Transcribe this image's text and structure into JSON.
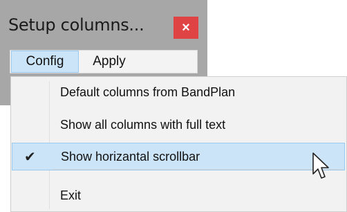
{
  "window": {
    "title": "Setup columns...",
    "close_glyph": "×"
  },
  "menubar": {
    "items": [
      {
        "label": "Config",
        "active": true
      },
      {
        "label": "Apply",
        "active": false
      }
    ]
  },
  "dropdown": {
    "items": [
      {
        "label": "Default columns from BandPlan",
        "checked": false,
        "highlighted": false
      },
      {
        "label": "Show all columns with full text",
        "checked": false,
        "highlighted": false
      },
      {
        "label": "Show horizantal scrollbar",
        "checked": true,
        "highlighted": true
      },
      {
        "label": "Exit",
        "checked": false,
        "highlighted": false
      }
    ],
    "check_glyph": "✔"
  },
  "icons": {
    "cursor": "arrow-cursor-icon",
    "close": "close-icon",
    "check": "check-icon"
  },
  "colors": {
    "highlight_bg": "#cce4f7",
    "highlight_border": "#99c9ef",
    "close_bg": "#e04343",
    "window_bg": "#a7a7a7"
  }
}
